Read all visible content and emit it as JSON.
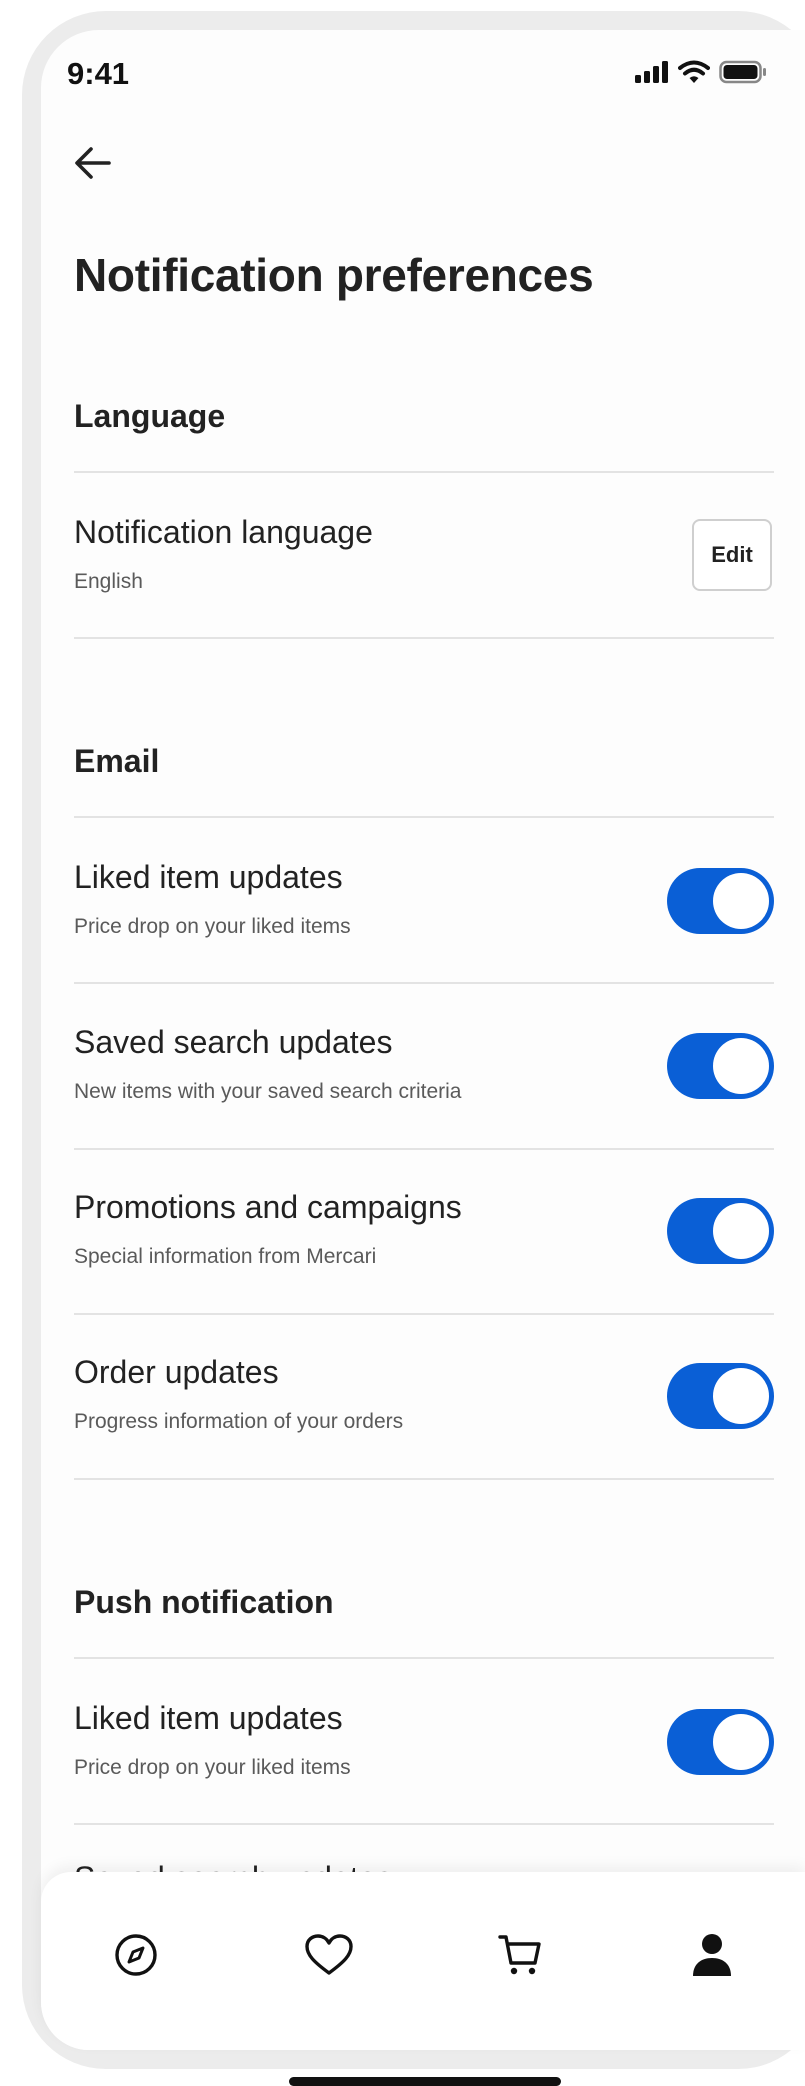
{
  "status_bar": {
    "time": "9:41"
  },
  "header": {
    "title": "Notification preferences"
  },
  "language": {
    "section_title": "Language",
    "row": {
      "title": "Notification language",
      "value": "English",
      "edit_label": "Edit"
    }
  },
  "email": {
    "section_title": "Email",
    "items": [
      {
        "title": "Liked item updates",
        "subtitle": "Price drop on your liked items",
        "enabled": true
      },
      {
        "title": "Saved search updates",
        "subtitle": "New items with your saved search criteria",
        "enabled": true
      },
      {
        "title": "Promotions and campaigns",
        "subtitle": "Special information from Mercari",
        "enabled": true
      },
      {
        "title": "Order updates",
        "subtitle": "Progress information of your orders",
        "enabled": true
      }
    ]
  },
  "push": {
    "section_title": "Push notification",
    "items": [
      {
        "title": "Liked item updates",
        "subtitle": "Price drop on your liked items",
        "enabled": true
      },
      {
        "title": "Saved search updates"
      }
    ]
  },
  "bottom_nav": {
    "items": [
      {
        "icon": "compass-icon"
      },
      {
        "icon": "heart-icon"
      },
      {
        "icon": "cart-icon"
      },
      {
        "icon": "profile-icon"
      }
    ]
  },
  "colors": {
    "accent": "#0a5fd6",
    "divider": "#e3e3e3",
    "text": "#222222"
  }
}
